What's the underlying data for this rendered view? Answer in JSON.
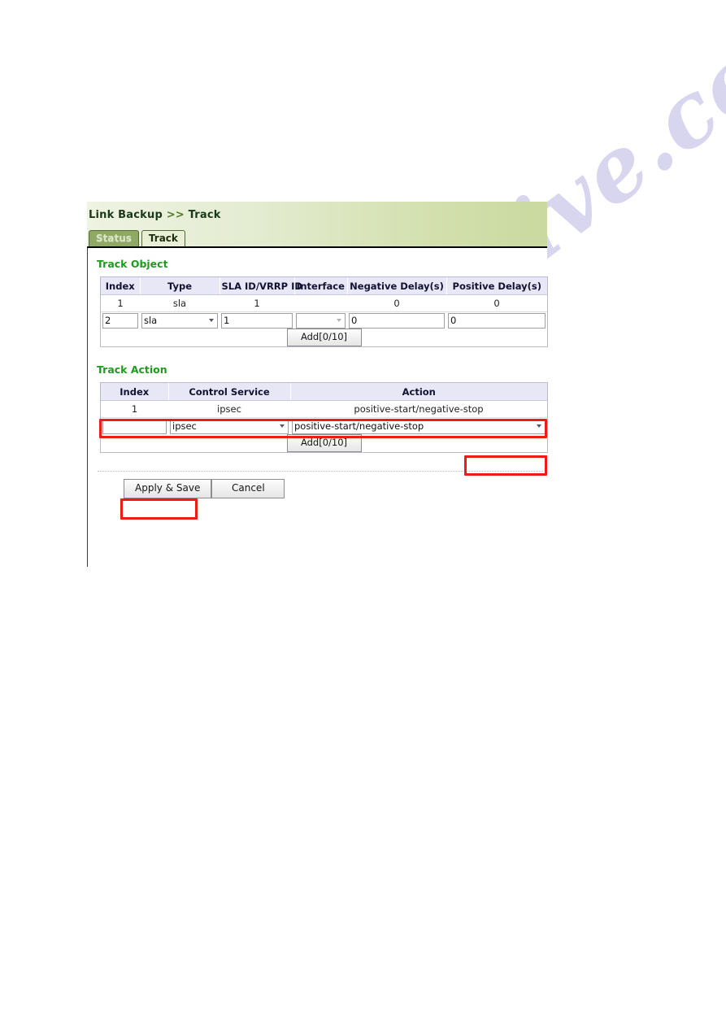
{
  "watermark": {
    "text": "manualshive.com"
  },
  "header": {
    "breadcrumb_root": "Link Backup",
    "breadcrumb_separator": ">>",
    "breadcrumb_current": "Track",
    "tabs": [
      {
        "label": "Status",
        "active": false
      },
      {
        "label": "Track",
        "active": true
      }
    ]
  },
  "track_object": {
    "title": "Track Object",
    "columns": [
      "Index",
      "Type",
      "SLA ID/VRRP ID",
      "Interface",
      "Negative Delay(s)",
      "Positive Delay(s)"
    ],
    "rows": [
      {
        "index": "1",
        "type": "sla",
        "sla_vrrp_id": "1",
        "interface": "",
        "negative_delay": "0",
        "positive_delay": "0"
      }
    ],
    "new_row": {
      "index": "2",
      "type": "sla",
      "sla_vrrp_id": "1",
      "interface": "",
      "negative_delay": "0",
      "positive_delay": "0"
    },
    "add_button": "Add[0/10]"
  },
  "track_action": {
    "title": "Track Action",
    "columns": [
      "Index",
      "Control Service",
      "Action"
    ],
    "rows": [
      {
        "index": "1",
        "control_service": "ipsec",
        "action": "positive-start/negative-stop"
      }
    ],
    "new_row": {
      "index": "",
      "control_service": "ipsec",
      "action": "positive-start/negative-stop"
    },
    "add_button": "Add[0/10]"
  },
  "footer": {
    "apply_label": "Apply & Save",
    "cancel_label": "Cancel"
  },
  "colors": {
    "accent_green": "#1d9b1d",
    "header_band_start": "#eef3e2",
    "header_band_end": "#c9d99f",
    "table_header_bg": "#e7e7f6",
    "annotation_red": "#ee1c12",
    "watermark": "#bab4e2"
  }
}
